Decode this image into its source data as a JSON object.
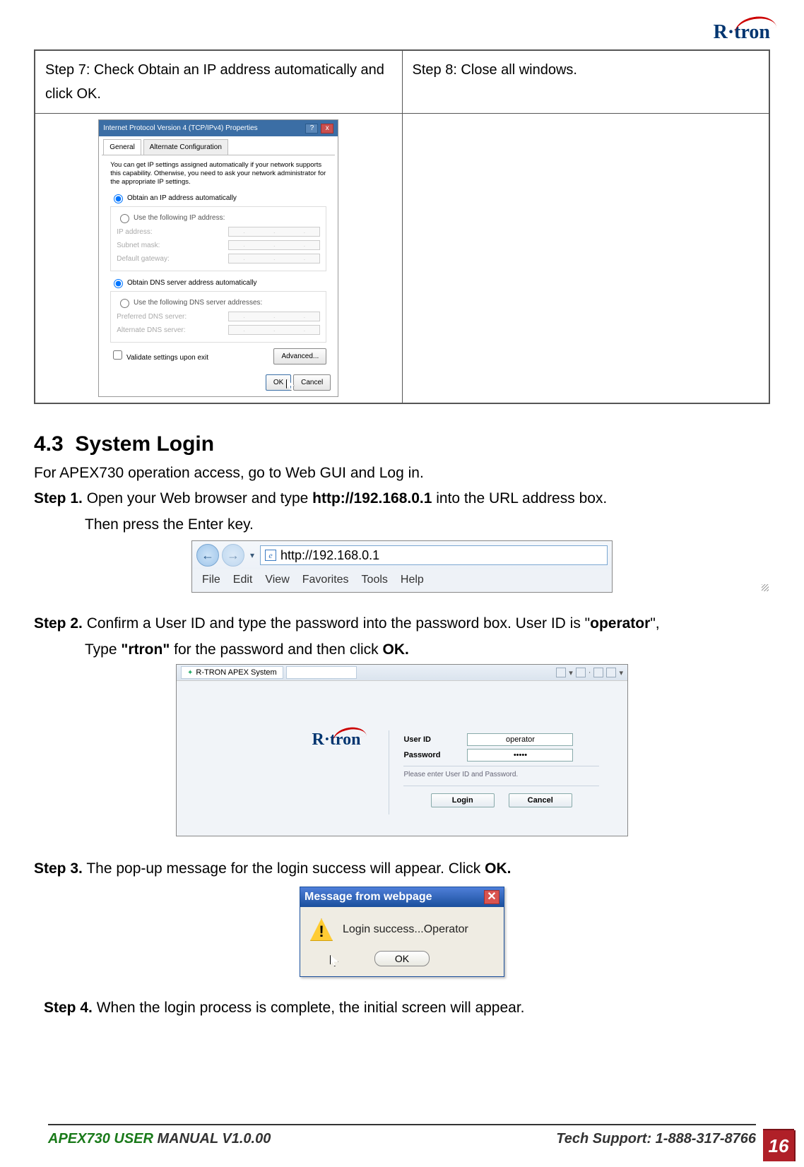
{
  "brand": "R·tron",
  "top_table": {
    "step7": "Step 7: Check Obtain an IP address automatically and click OK.",
    "step8": "Step 8: Close all windows."
  },
  "ipv4": {
    "title": "Internet Protocol Version 4 (TCP/IPv4) Properties",
    "help": "?",
    "close": "x",
    "tab_general": "General",
    "tab_alt": "Alternate Configuration",
    "note": "You can get IP settings assigned automatically if your network supports this capability. Otherwise, you need to ask your network administrator for the appropriate IP settings.",
    "r_auto_ip": "Obtain an IP address automatically",
    "r_static_ip": "Use the following IP address:",
    "ip_label": "IP address:",
    "subnet_label": "Subnet mask:",
    "gw_label": "Default gateway:",
    "r_auto_dns": "Obtain DNS server address automatically",
    "r_static_dns": "Use the following DNS server addresses:",
    "pref_dns": "Preferred DNS server:",
    "alt_dns": "Alternate DNS server:",
    "validate": "Validate settings upon exit",
    "advanced": "Advanced...",
    "ok": "OK",
    "cancel": "Cancel"
  },
  "section": {
    "num": "4.3",
    "title": "System Login",
    "intro": "For APEX730 operation access, go to Web GUI and Log in.",
    "step1_label": "Step 1.",
    "step1a": " Open your Web browser and type ",
    "step1_url": "http://192.168.0.1",
    "step1b": " into the URL address box.",
    "step1c": "Then press the Enter key.",
    "step2_label": "Step 2.",
    "step2a": " Confirm a User ID and type the password into the password box. User ID is \"",
    "step2_user": "operator",
    "step2b": "\",",
    "step2c": "Type ",
    "step2_pw_q1": "\"",
    "step2_pw": "rtron",
    "step2_pw_q2": "\"",
    "step2d": " for the password and then click ",
    "step2_ok": "OK.",
    "step3_label": "Step 3.",
    "step3a": " The pop-up message for the login success will appear. Click ",
    "step3_ok": "OK.",
    "step4_label": "Step 4.",
    "step4a": " When the login process is complete, the initial screen will appear."
  },
  "ie": {
    "url": "http://192.168.0.1",
    "menu": [
      "File",
      "Edit",
      "View",
      "Favorites",
      "Tools",
      "Help"
    ]
  },
  "login": {
    "tab_title": "R-TRON APEX System",
    "user_id_label": "User ID",
    "user_id_value": "operator",
    "password_label": "Password",
    "password_value": "•••••",
    "hint": "Please enter User ID and Password.",
    "login_btn": "Login",
    "cancel_btn": "Cancel"
  },
  "msgbox": {
    "title": "Message from webpage",
    "text": "Login success...Operator",
    "ok": "OK"
  },
  "footer": {
    "left_green": "APEX730 USER",
    "left_rest": " MANUAL V1.0.00",
    "right": "Tech Support: 1-888-317-8766",
    "page": "16"
  }
}
